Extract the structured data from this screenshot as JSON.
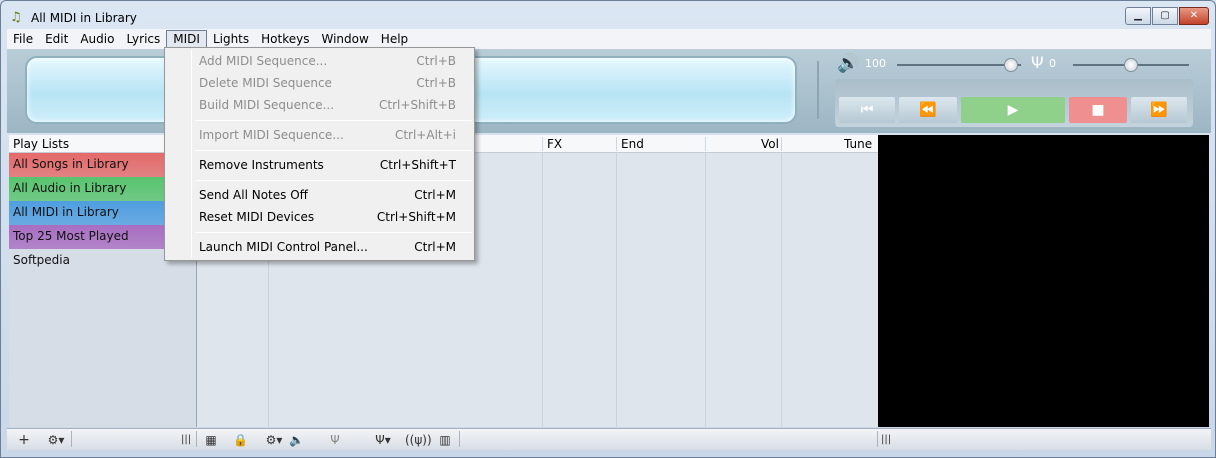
{
  "window": {
    "title": "All MIDI in Library"
  },
  "menubar": {
    "items": [
      "File",
      "Edit",
      "Audio",
      "Lyrics",
      "MIDI",
      "Lights",
      "Hotkeys",
      "Window",
      "Help"
    ],
    "active": "MIDI"
  },
  "player": {
    "volume": "100",
    "tune": "0",
    "volume_level": 0.92,
    "tune_level": 0.5
  },
  "sidebar": {
    "header": "Play Lists",
    "items": [
      {
        "label": "All Songs in Library",
        "color": "#e46a6a"
      },
      {
        "label": "All Audio in Library",
        "color": "#57c46d"
      },
      {
        "label": "All MIDI in Library",
        "color": "#4f9ee0"
      },
      {
        "label": "Top 25 Most Played",
        "color": "#a86ec2"
      },
      {
        "label": "Softpedia",
        "color": ""
      }
    ]
  },
  "table": {
    "columns": [
      "FX",
      "End",
      "Vol",
      "Tune"
    ]
  },
  "midi_menu": {
    "items": [
      {
        "label": "Add MIDI Sequence...",
        "shortcut": "Ctrl+B",
        "disabled": true
      },
      {
        "label": "Delete MIDI Sequence",
        "shortcut": "Ctrl+B",
        "disabled": true
      },
      {
        "label": "Build MIDI Sequence...",
        "shortcut": "Ctrl+Shift+B",
        "disabled": true
      },
      {
        "label": "Import MIDI Sequence...",
        "shortcut": "Ctrl+Alt+i",
        "disabled": true
      },
      {
        "label": "Remove Instruments",
        "shortcut": "Ctrl+Shift+T",
        "disabled": false
      },
      {
        "label": "Send All Notes Off",
        "shortcut": "Ctrl+M",
        "disabled": false
      },
      {
        "label": "Reset MIDI Devices",
        "shortcut": "Ctrl+Shift+M",
        "disabled": false
      },
      {
        "label": "Launch MIDI Control Panel...",
        "shortcut": "Ctrl+M",
        "disabled": false
      }
    ]
  },
  "icons": {
    "app": "music-note-icon",
    "volume": "speaker-icon",
    "tune": "tuning-fork-icon"
  },
  "colors": {
    "play_button": "#8fd18b",
    "stop_button": "#ef8f8f",
    "video_background": "#000000"
  }
}
